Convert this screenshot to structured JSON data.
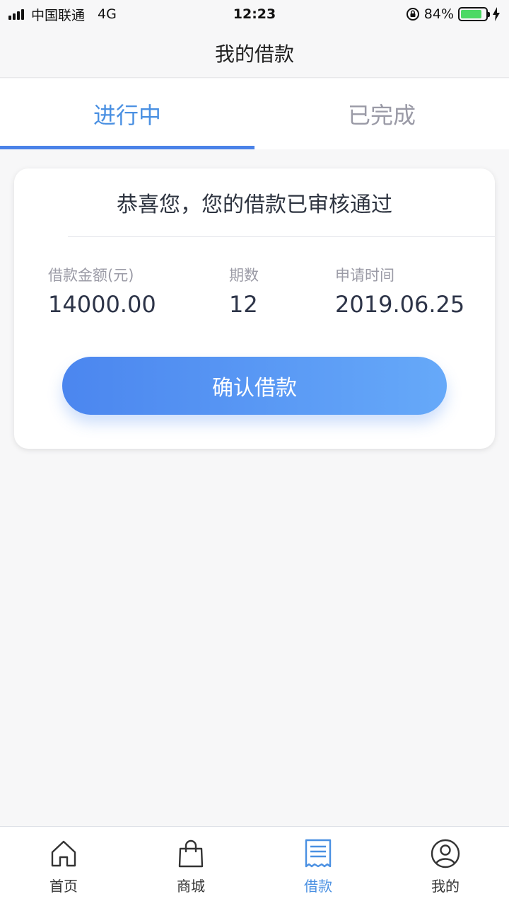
{
  "status_bar": {
    "carrier": "中国联通",
    "network": "4G",
    "time": "12:23",
    "battery_percent": "84%",
    "battery_level": 0.84
  },
  "nav": {
    "title": "我的借款"
  },
  "tabs": [
    {
      "label": "进行中",
      "active": true
    },
    {
      "label": "已完成",
      "active": false
    }
  ],
  "card": {
    "title": "恭喜您，您的借款已审核通过",
    "amount_label": "借款金额(元)",
    "amount_value": "14000.00",
    "period_label": "期数",
    "period_value": "12",
    "date_label": "申请时间",
    "date_value": "2019.06.25",
    "confirm_label": "确认借款"
  },
  "bottom_nav": [
    {
      "label": "首页",
      "icon": "home-icon",
      "active": false
    },
    {
      "label": "商城",
      "icon": "shopping-bag-icon",
      "active": false
    },
    {
      "label": "借款",
      "icon": "receipt-icon",
      "active": true
    },
    {
      "label": "我的",
      "icon": "user-icon",
      "active": false
    }
  ],
  "colors": {
    "accent": "#4a90e2",
    "battery": "#4cd964",
    "button_start": "#4b86ef",
    "button_end": "#66a9f9"
  }
}
